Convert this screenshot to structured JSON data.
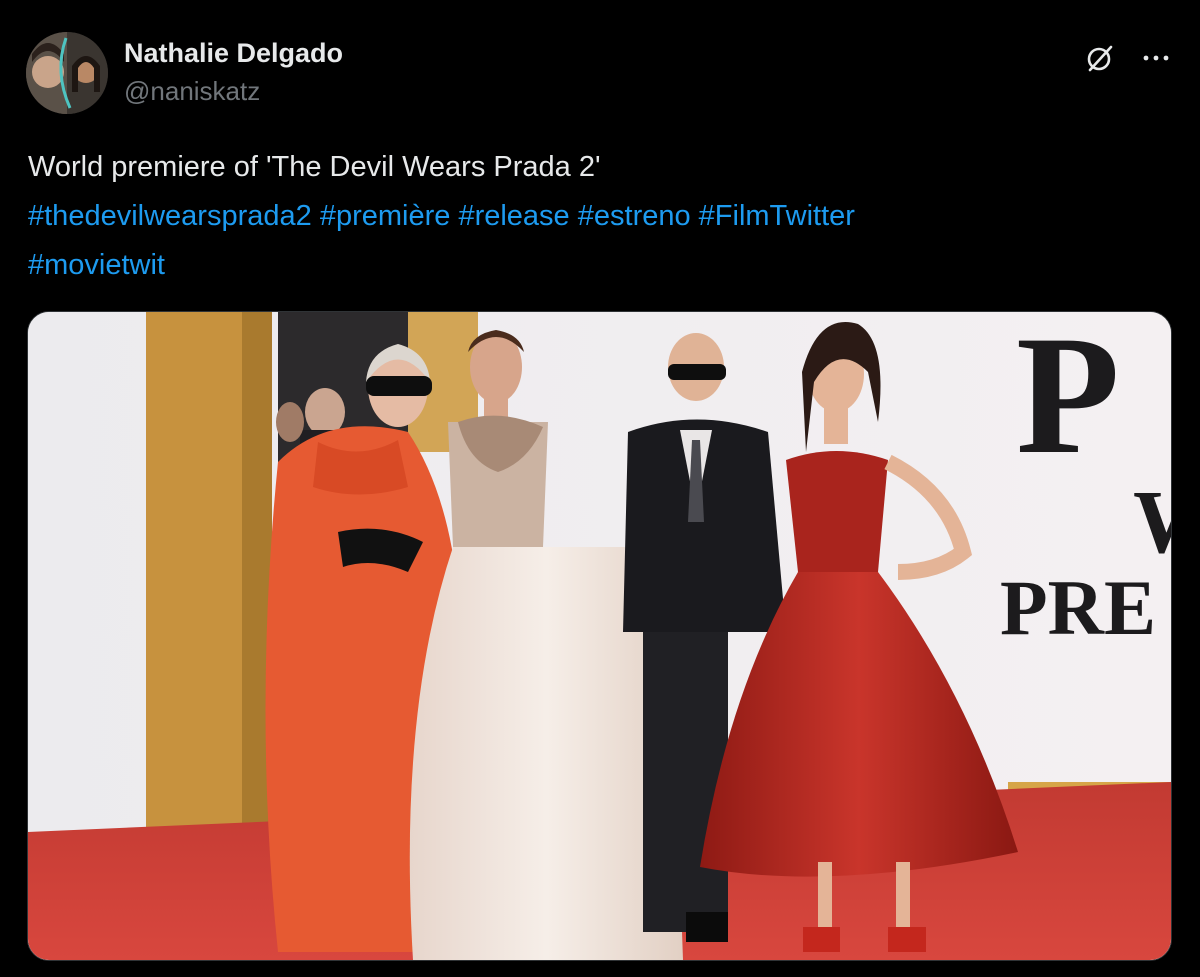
{
  "user": {
    "display_name": "Nathalie Delgado",
    "handle": "@naniskatz"
  },
  "icons": {
    "grok": "grok-icon",
    "more": "more-options-icon"
  },
  "tweet": {
    "text": "World premiere of 'The Devil Wears Prada 2'",
    "hashtags": [
      "#thedevilwearsprada2",
      "#première",
      "#release",
      "#estreno",
      "#FilmTwitter",
      "#movietwit"
    ]
  },
  "media": {
    "backdrop_letters": {
      "line1": "P",
      "line2": "W",
      "line3": "PRE"
    }
  },
  "colors": {
    "background": "#000000",
    "text": "#e7e9ea",
    "secondary": "#71767b",
    "link": "#1d9bf0",
    "carpet": "#c8322e",
    "pillar": "#c7923e",
    "cape": "#e65a32",
    "red_gown": "#b8241c",
    "ivory_gown": "#efe4dc",
    "suit": "#1a1a1e"
  }
}
